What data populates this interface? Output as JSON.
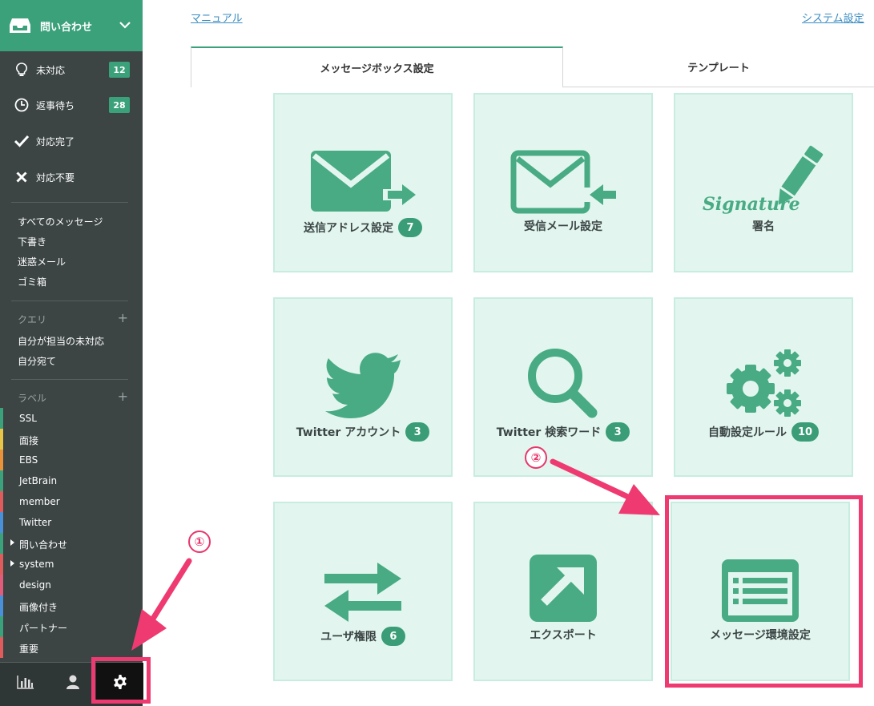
{
  "sidebar": {
    "inbox_title": "問い合わせ",
    "status_items": [
      {
        "label": "未対応",
        "count": "12"
      },
      {
        "label": "返事待ち",
        "count": "28"
      },
      {
        "label": "対応完了"
      },
      {
        "label": "対応不要"
      }
    ],
    "mailboxes": [
      "すべてのメッセージ",
      "下書き",
      "迷惑メール",
      "ゴミ箱"
    ],
    "query_header": "クエリ",
    "queries": [
      "自分が担当の未対応",
      "自分宛て"
    ],
    "label_header": "ラベル",
    "labels": [
      {
        "name": "SSL",
        "color": "#3aa17b"
      },
      {
        "name": "面接",
        "color": "#e8c547"
      },
      {
        "name": "EBS",
        "color": "#e8933a"
      },
      {
        "name": "JetBrain",
        "color": "#3aa17b"
      },
      {
        "name": "member",
        "color": "#e05c5c"
      },
      {
        "name": "Twitter",
        "color": "#4a90d9"
      },
      {
        "name": "問い合わせ",
        "color": "#3aa17b"
      },
      {
        "name": "system",
        "color": "#e05c5c"
      },
      {
        "name": "design",
        "color": "#e05c7a"
      },
      {
        "name": "画像付き",
        "color": "#4a90d9"
      },
      {
        "name": "パートナー",
        "color": "#3aa17b"
      },
      {
        "name": "重要",
        "color": "#e05c5c"
      }
    ]
  },
  "header": {
    "manual_link": "マニュアル",
    "system_link": "システム設定"
  },
  "tabs": [
    "メッセージボックス設定",
    "テンプレート"
  ],
  "cards": [
    {
      "label": "送信アドレス設定",
      "count": "7",
      "icon": "mail-send-icon"
    },
    {
      "label": "受信メール設定",
      "icon": "mail-receive-icon"
    },
    {
      "label": "署名",
      "icon": "signature-icon",
      "signature_text": "Signature"
    },
    {
      "label": "Twitter アカウント",
      "count": "3",
      "icon": "twitter-bird-icon"
    },
    {
      "label": "Twitter 検索ワード",
      "count": "3",
      "icon": "search-icon"
    },
    {
      "label": "自動設定ルール",
      "count": "10",
      "icon": "gears-icon"
    },
    {
      "label": "ユーザ権限",
      "count": "6",
      "icon": "swap-arrows-icon"
    },
    {
      "label": "エクスポート",
      "icon": "export-icon"
    },
    {
      "label": "メッセージ環境設定",
      "icon": "list-window-icon"
    }
  ],
  "annotations": {
    "marker1": "①",
    "marker2": "②"
  },
  "colors": {
    "accent": "#3aa17b",
    "card_bg": "#e2f6ef",
    "highlight": "#ee3a71"
  }
}
